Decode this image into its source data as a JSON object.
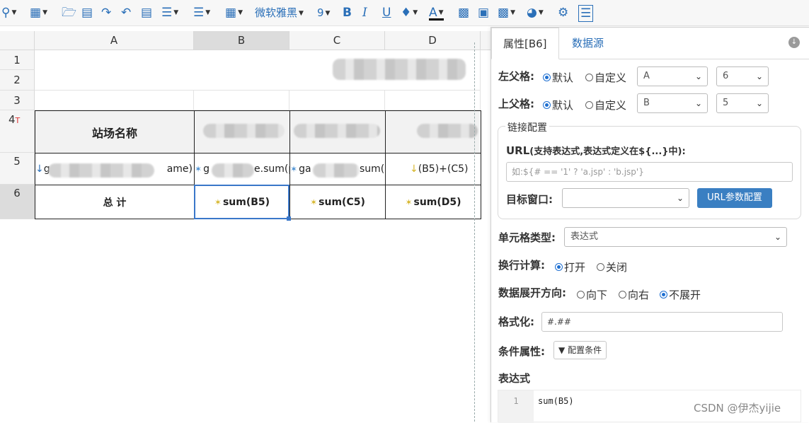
{
  "toolbar": {
    "font_name": "微软雅黑",
    "font_size": "9",
    "bold_glyph": "B",
    "italic_glyph": "I",
    "underline_glyph": "U",
    "font_color_glyph": "A"
  },
  "sheet": {
    "columns": [
      "A",
      "B",
      "C",
      "D"
    ],
    "rows": [
      "1",
      "2",
      "3",
      "4",
      "5",
      "6"
    ],
    "row4_marker": "T",
    "cells": {
      "a4": "站场名称",
      "a5": "g",
      "a5_tail": "ame)",
      "b5": "g",
      "b5_tail": "e.sum(p",
      "c5": "ga",
      "c5_tail": "sum(c",
      "d5": "(B5)+(C5)",
      "a6": "总 计",
      "b6": "sum(B5)",
      "c6": "sum(C5)",
      "d6": "sum(D5)"
    }
  },
  "panel": {
    "tabs": [
      {
        "label": "属性[B6]"
      },
      {
        "label": "数据源"
      }
    ],
    "left_parent": {
      "label": "左父格:",
      "opt_default": "默认",
      "opt_custom": "自定义",
      "col": "A",
      "row": "6"
    },
    "top_parent": {
      "label": "上父格:",
      "opt_default": "默认",
      "opt_custom": "自定义",
      "col": "B",
      "row": "5"
    },
    "link": {
      "legend": "链接配置",
      "url_label": "URL",
      "url_hint": "(支持表达式,表达式定义在${...}中):",
      "url_placeholder": "如:${# == '1' ? 'a.jsp' : 'b.jsp'}",
      "target_label": "目标窗口:",
      "target_value": "",
      "param_button": "URL参数配置"
    },
    "cell_type": {
      "label": "单元格类型:",
      "value": "表达式"
    },
    "line_calc": {
      "label": "换行计算:",
      "opt_on": "打开",
      "opt_off": "关闭"
    },
    "expand": {
      "label": "数据展开方向:",
      "opt_down": "向下",
      "opt_right": "向右",
      "opt_none": "不展开"
    },
    "format": {
      "label": "格式化:",
      "value": "#.##"
    },
    "condition": {
      "label": "条件属性:",
      "button": "配置条件"
    },
    "expression": {
      "label": "表达式",
      "line_no": "1",
      "code": "sum(B5)"
    }
  },
  "watermark": "CSDN @伊杰yijie",
  "colors": {
    "accent": "#2a6fb8",
    "selection": "#3a77c9",
    "primary_button": "#3a7fc2"
  }
}
